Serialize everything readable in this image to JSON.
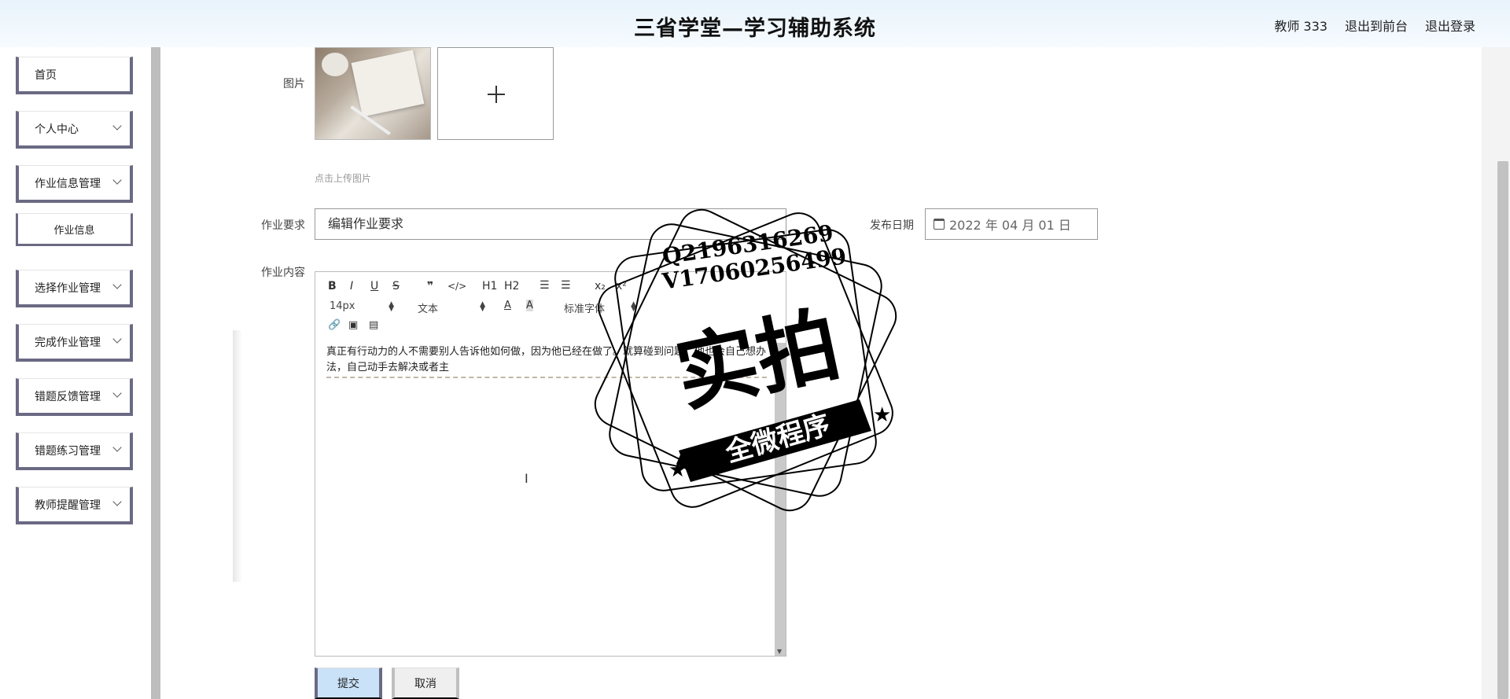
{
  "header": {
    "title": "三省学堂—学习辅助系统",
    "user": "教师 333",
    "front_link": "退出到前台",
    "logout_link": "退出登录"
  },
  "sidebar": {
    "items": [
      {
        "label": "首页"
      },
      {
        "label": "个人中心"
      },
      {
        "label": "作业信息管理"
      },
      {
        "label": "作业信息"
      },
      {
        "label": "选择作业管理"
      },
      {
        "label": "完成作业管理"
      },
      {
        "label": "错题反馈管理"
      },
      {
        "label": "错题练习管理"
      },
      {
        "label": "教师提醒管理"
      }
    ]
  },
  "form": {
    "image_label": "图片",
    "upload_hint": "点击上传图片",
    "requirement_label": "作业要求",
    "requirement_value": "编辑作业要求",
    "date_label": "发布日期",
    "date_value": "2022 年 04 月 01 日",
    "content_label": "作业内容",
    "content_text": "真正有行动力的人不需要别人告诉他如何做，因为他已经在做了。就算碰到问题，他也会自己想办法，自己动手去解决或者主",
    "submit_label": "提交",
    "cancel_label": "取消"
  },
  "editor_toolbar": {
    "bold": "B",
    "italic": "I",
    "underline": "U",
    "strike": "S",
    "quote": "❞",
    "code": "</>",
    "h1": "H1",
    "h2": "H2",
    "ordered_list": "☰",
    "bullet_list": "☰",
    "subscript": "x₂",
    "superscript": "x²",
    "font_size": "14px",
    "paragraph": "文本",
    "font_family": "标准字体"
  },
  "watermark": {
    "line1": "Q2196316269",
    "line2": "V17060256499",
    "big": "实拍",
    "banner": "全微程序"
  }
}
